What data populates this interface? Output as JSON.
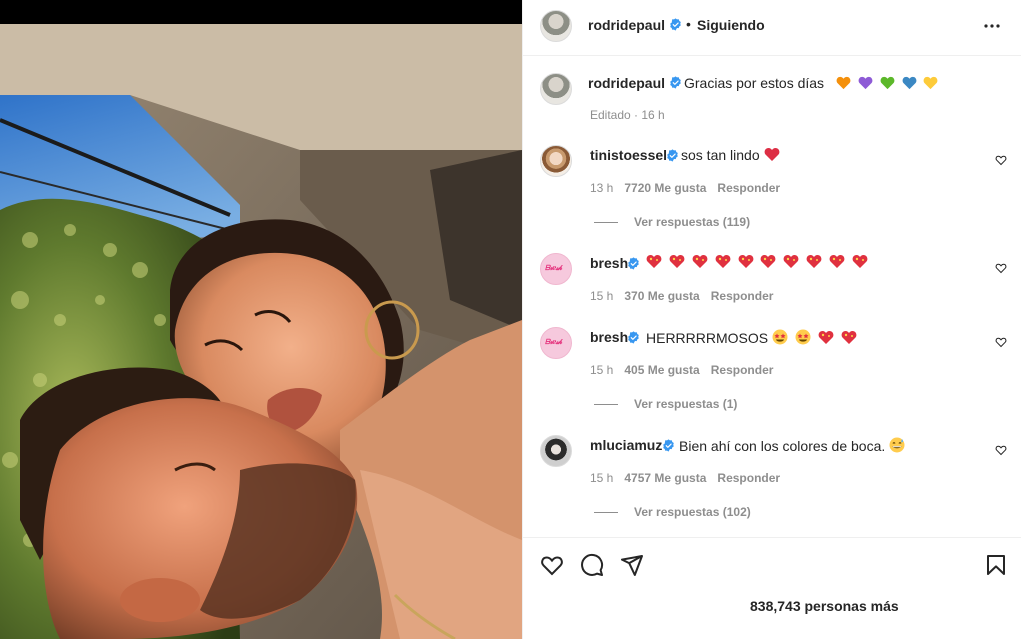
{
  "post": {
    "author": "rodridepaul",
    "header_separator": "•",
    "follow_status": "Siguiendo",
    "caption": "Gracias por estos días",
    "caption_emojis": [
      "orange-heart",
      "purple-heart",
      "green-heart",
      "blue-heart",
      "yellow-heart"
    ],
    "edited_time": "Editado · 16 h",
    "likes_text": "838,743 personas más"
  },
  "comments": [
    {
      "username": "tinistoessel",
      "text": "sos tan lindo",
      "emojis": [
        "red-heart"
      ],
      "time": "13 h",
      "likes": "7720 Me gusta",
      "reply_label": "Responder",
      "view_replies": "Ver respuestas (119)"
    },
    {
      "username": "bresh",
      "text": "",
      "emojis": [
        "heart-with-stars",
        "heart-with-stars",
        "heart-with-stars",
        "heart-with-stars",
        "heart-with-stars",
        "heart-with-stars",
        "heart-with-stars",
        "heart-with-stars",
        "heart-with-stars",
        "heart-with-stars"
      ],
      "time": "15 h",
      "likes": "370 Me gusta",
      "reply_label": "Responder",
      "view_replies": ""
    },
    {
      "username": "bresh",
      "text": "HERRRRRMOSOS",
      "emojis": [
        "star-struck",
        "star-struck",
        "heart-with-stars",
        "heart-with-stars"
      ],
      "time": "15 h",
      "likes": "405 Me gusta",
      "reply_label": "Responder",
      "view_replies": "Ver respuestas (1)"
    },
    {
      "username": "mluciamuz",
      "text": "Bien ahí con los colores de boca.",
      "emojis": [
        "grinning-sweat"
      ],
      "time": "15 h",
      "likes": "4757 Me gusta",
      "reply_label": "Responder",
      "view_replies": "Ver respuestas (102)"
    }
  ],
  "colors": {
    "verified_blue": "#3897f0",
    "text_primary": "#262626",
    "text_secondary": "#8e8e8e",
    "divider": "#efefef"
  }
}
